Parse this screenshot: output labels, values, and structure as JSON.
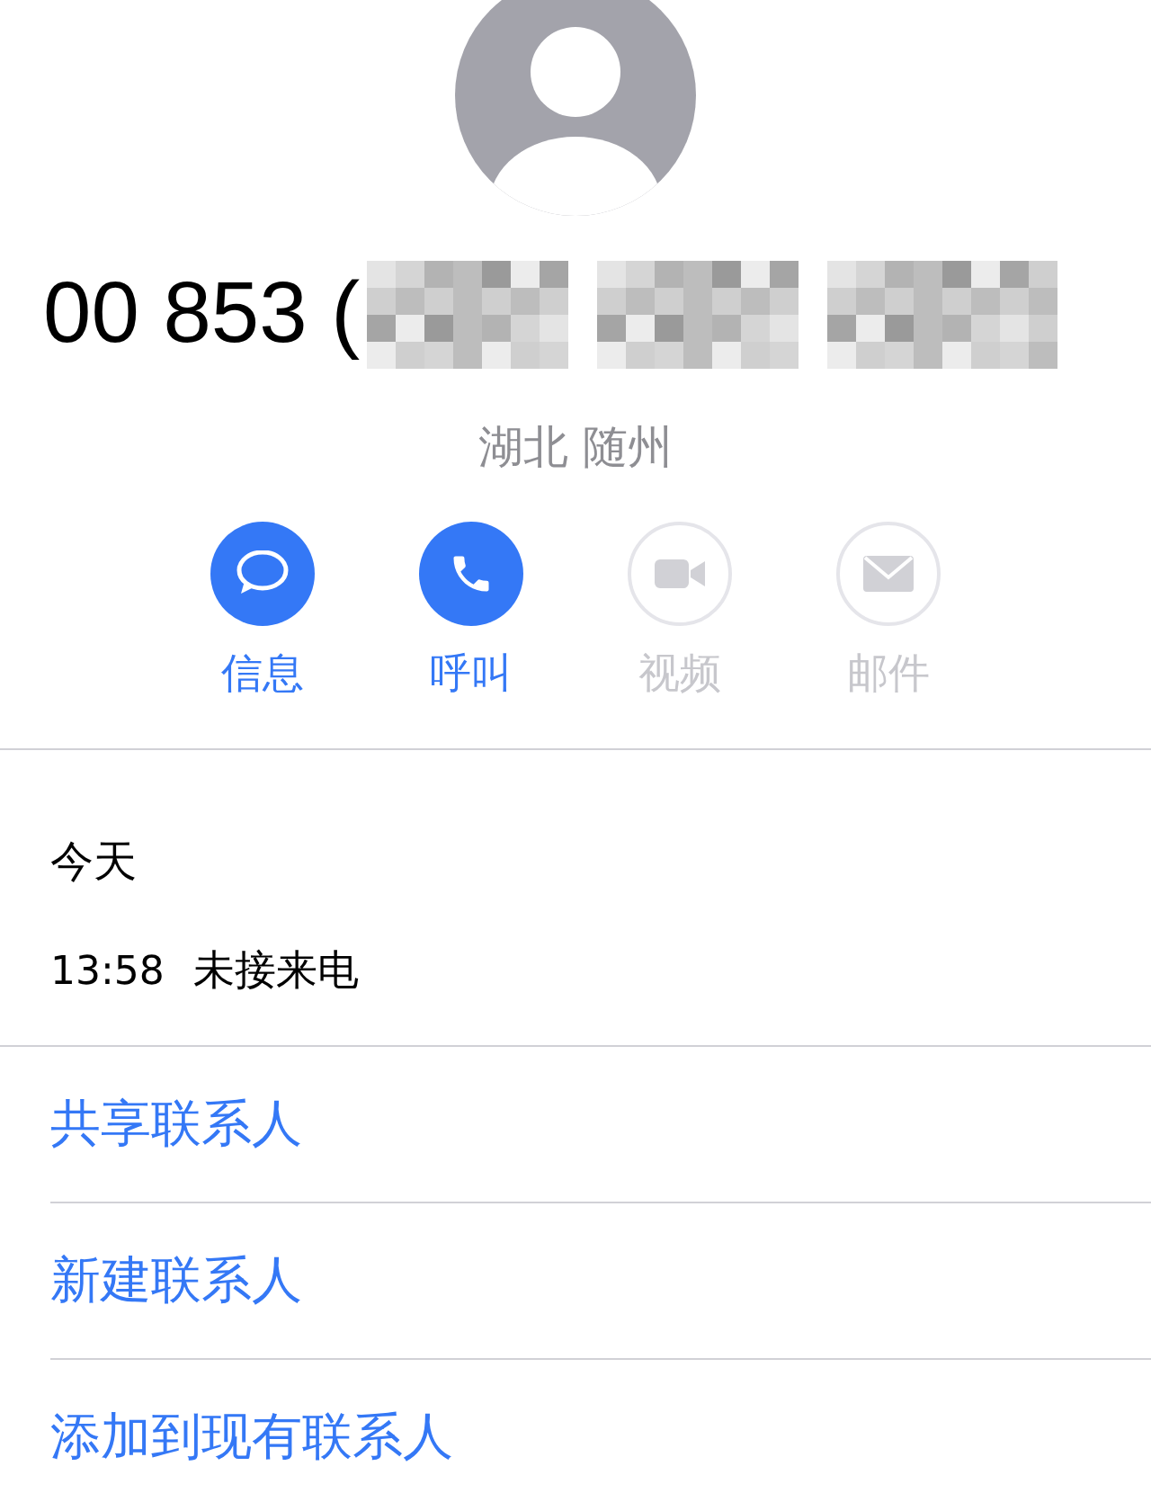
{
  "caller": {
    "number": "00 853 (",
    "location": "湖北 随州"
  },
  "actions": [
    {
      "kind": "message",
      "label": "信息",
      "disabled": false
    },
    {
      "kind": "call",
      "label": "呼叫",
      "disabled": false
    },
    {
      "kind": "video",
      "label": "视频",
      "disabled": true
    },
    {
      "kind": "mail",
      "label": "邮件",
      "disabled": true
    }
  ],
  "history": {
    "day": "今天",
    "entries": [
      {
        "time": "13:58",
        "type": "未接来电"
      }
    ]
  },
  "links": [
    "共享联系人",
    "新建联系人",
    "添加到现有联系人"
  ]
}
